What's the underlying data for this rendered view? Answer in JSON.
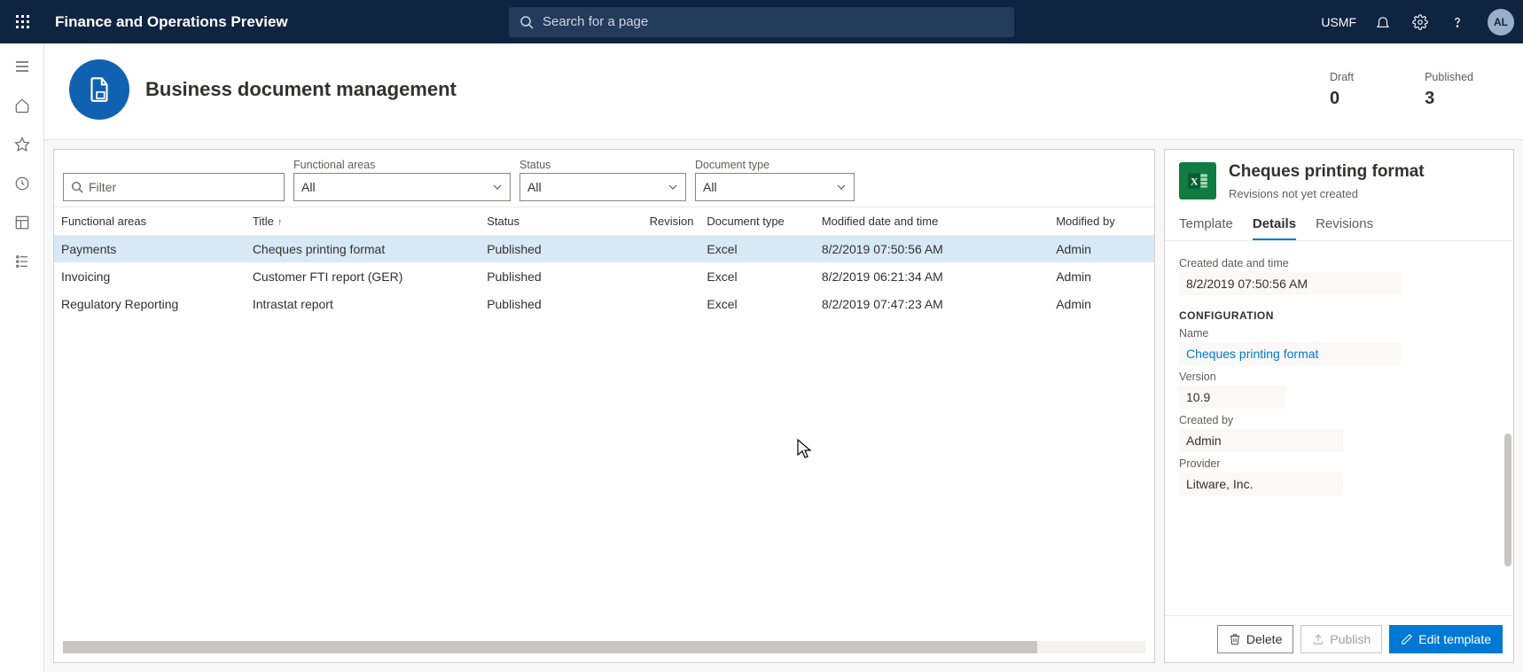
{
  "topbar": {
    "app_title": "Finance and Operations Preview",
    "search_placeholder": "Search for a page",
    "company": "USMF",
    "avatar_initials": "AL"
  },
  "page": {
    "title": "Business document management",
    "stats": {
      "draft_label": "Draft",
      "draft_value": "0",
      "published_label": "Published",
      "published_value": "3"
    }
  },
  "filters": {
    "filter_placeholder": "Filter",
    "functional_label": "Functional areas",
    "functional_value": "All",
    "status_label": "Status",
    "status_value": "All",
    "doctype_label": "Document type",
    "doctype_value": "All"
  },
  "columns": {
    "c0": "Functional areas",
    "c1": "Title",
    "c2": "Status",
    "c3": "Revision",
    "c4": "Document type",
    "c5": "Modified date and time",
    "c6": "Modified by"
  },
  "rows": [
    {
      "func": "Payments",
      "title": "Cheques printing format",
      "status": "Published",
      "revision": "",
      "doctype": "Excel",
      "modified": "8/2/2019 07:50:56 AM",
      "by": "Admin"
    },
    {
      "func": "Invoicing",
      "title": "Customer FTI report (GER)",
      "status": "Published",
      "revision": "",
      "doctype": "Excel",
      "modified": "8/2/2019 06:21:34 AM",
      "by": "Admin"
    },
    {
      "func": "Regulatory Reporting",
      "title": "Intrastat report",
      "status": "Published",
      "revision": "",
      "doctype": "Excel",
      "modified": "8/2/2019 07:47:23 AM",
      "by": "Admin"
    }
  ],
  "detail": {
    "title": "Cheques printing format",
    "subtitle": "Revisions not yet created",
    "tabs": {
      "t0": "Template",
      "t1": "Details",
      "t2": "Revisions"
    },
    "created_label": "Created date and time",
    "created_value": "8/2/2019 07:50:56 AM",
    "config_section": "CONFIGURATION",
    "name_label": "Name",
    "name_value": "Cheques printing format",
    "version_label": "Version",
    "version_value": "10.9",
    "createdby_label": "Created by",
    "createdby_value": "Admin",
    "provider_label": "Provider",
    "provider_value": "Litware, Inc.",
    "buttons": {
      "delete": "Delete",
      "publish": "Publish",
      "edit": "Edit template"
    }
  }
}
